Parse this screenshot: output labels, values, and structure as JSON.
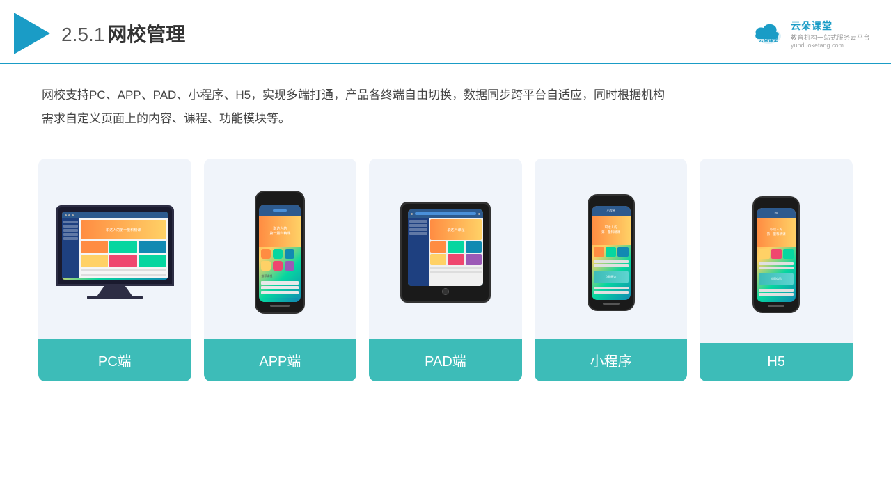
{
  "header": {
    "title_prefix": "2.5.1",
    "title_main": "网校管理",
    "brand_name": "云朵课堂",
    "brand_tagline": "教育机构一站式服务云平台",
    "brand_url": "yunduoketang.com"
  },
  "description": {
    "text1": "网校支持PC、APP、PAD、小程序、H5，实现多端打通，产品各终端自由切换，数据同步跨平台自适应，同时根据机构",
    "text2": "需求自定义页面上的内容、课程、功能模块等。"
  },
  "cards": [
    {
      "id": "pc",
      "label": "PC端"
    },
    {
      "id": "app",
      "label": "APP端"
    },
    {
      "id": "pad",
      "label": "PAD端"
    },
    {
      "id": "miniapp",
      "label": "小程序"
    },
    {
      "id": "h5",
      "label": "H5"
    }
  ]
}
